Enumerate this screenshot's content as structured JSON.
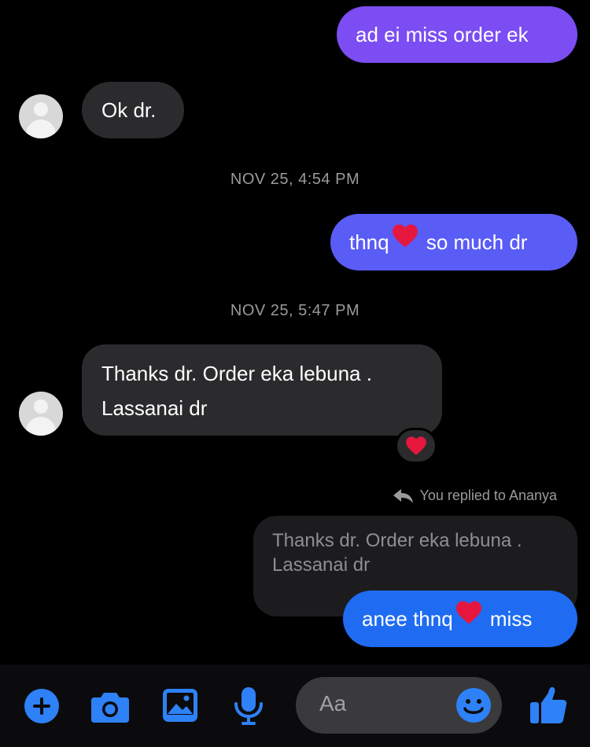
{
  "messages": {
    "m1": {
      "text": "ad ei miss order ek"
    },
    "m2": {
      "text": "Ok dr."
    },
    "ts1": "NOV 25, 4:54 PM",
    "m3": {
      "before": "thnq",
      "after": " so much dr"
    },
    "ts2": "NOV 25, 5:47 PM",
    "m4": {
      "line1": "Thanks dr. Order eka lebuna .",
      "line2": "Lassanai dr"
    },
    "reply": {
      "label": "You replied to Ananya",
      "quote_line1": "Thanks dr. Order eka lebuna .",
      "quote_line2": "Lassanai dr"
    },
    "m5": {
      "before": "anee thnq",
      "after": " miss"
    }
  },
  "composer": {
    "placeholder": "Aa",
    "icons": [
      "plus-icon",
      "camera-icon",
      "photo-icon",
      "microphone-icon",
      "emoji-icon",
      "thumbs-up-icon"
    ]
  },
  "colors": {
    "sent_purple": "#7b4df2",
    "sent_blue_purple": "#5a5cf6",
    "sent_blue": "#1f6cf2",
    "received": "#2b2b2d",
    "accent_blue": "#2e81f6",
    "heart": "#e5173f"
  }
}
